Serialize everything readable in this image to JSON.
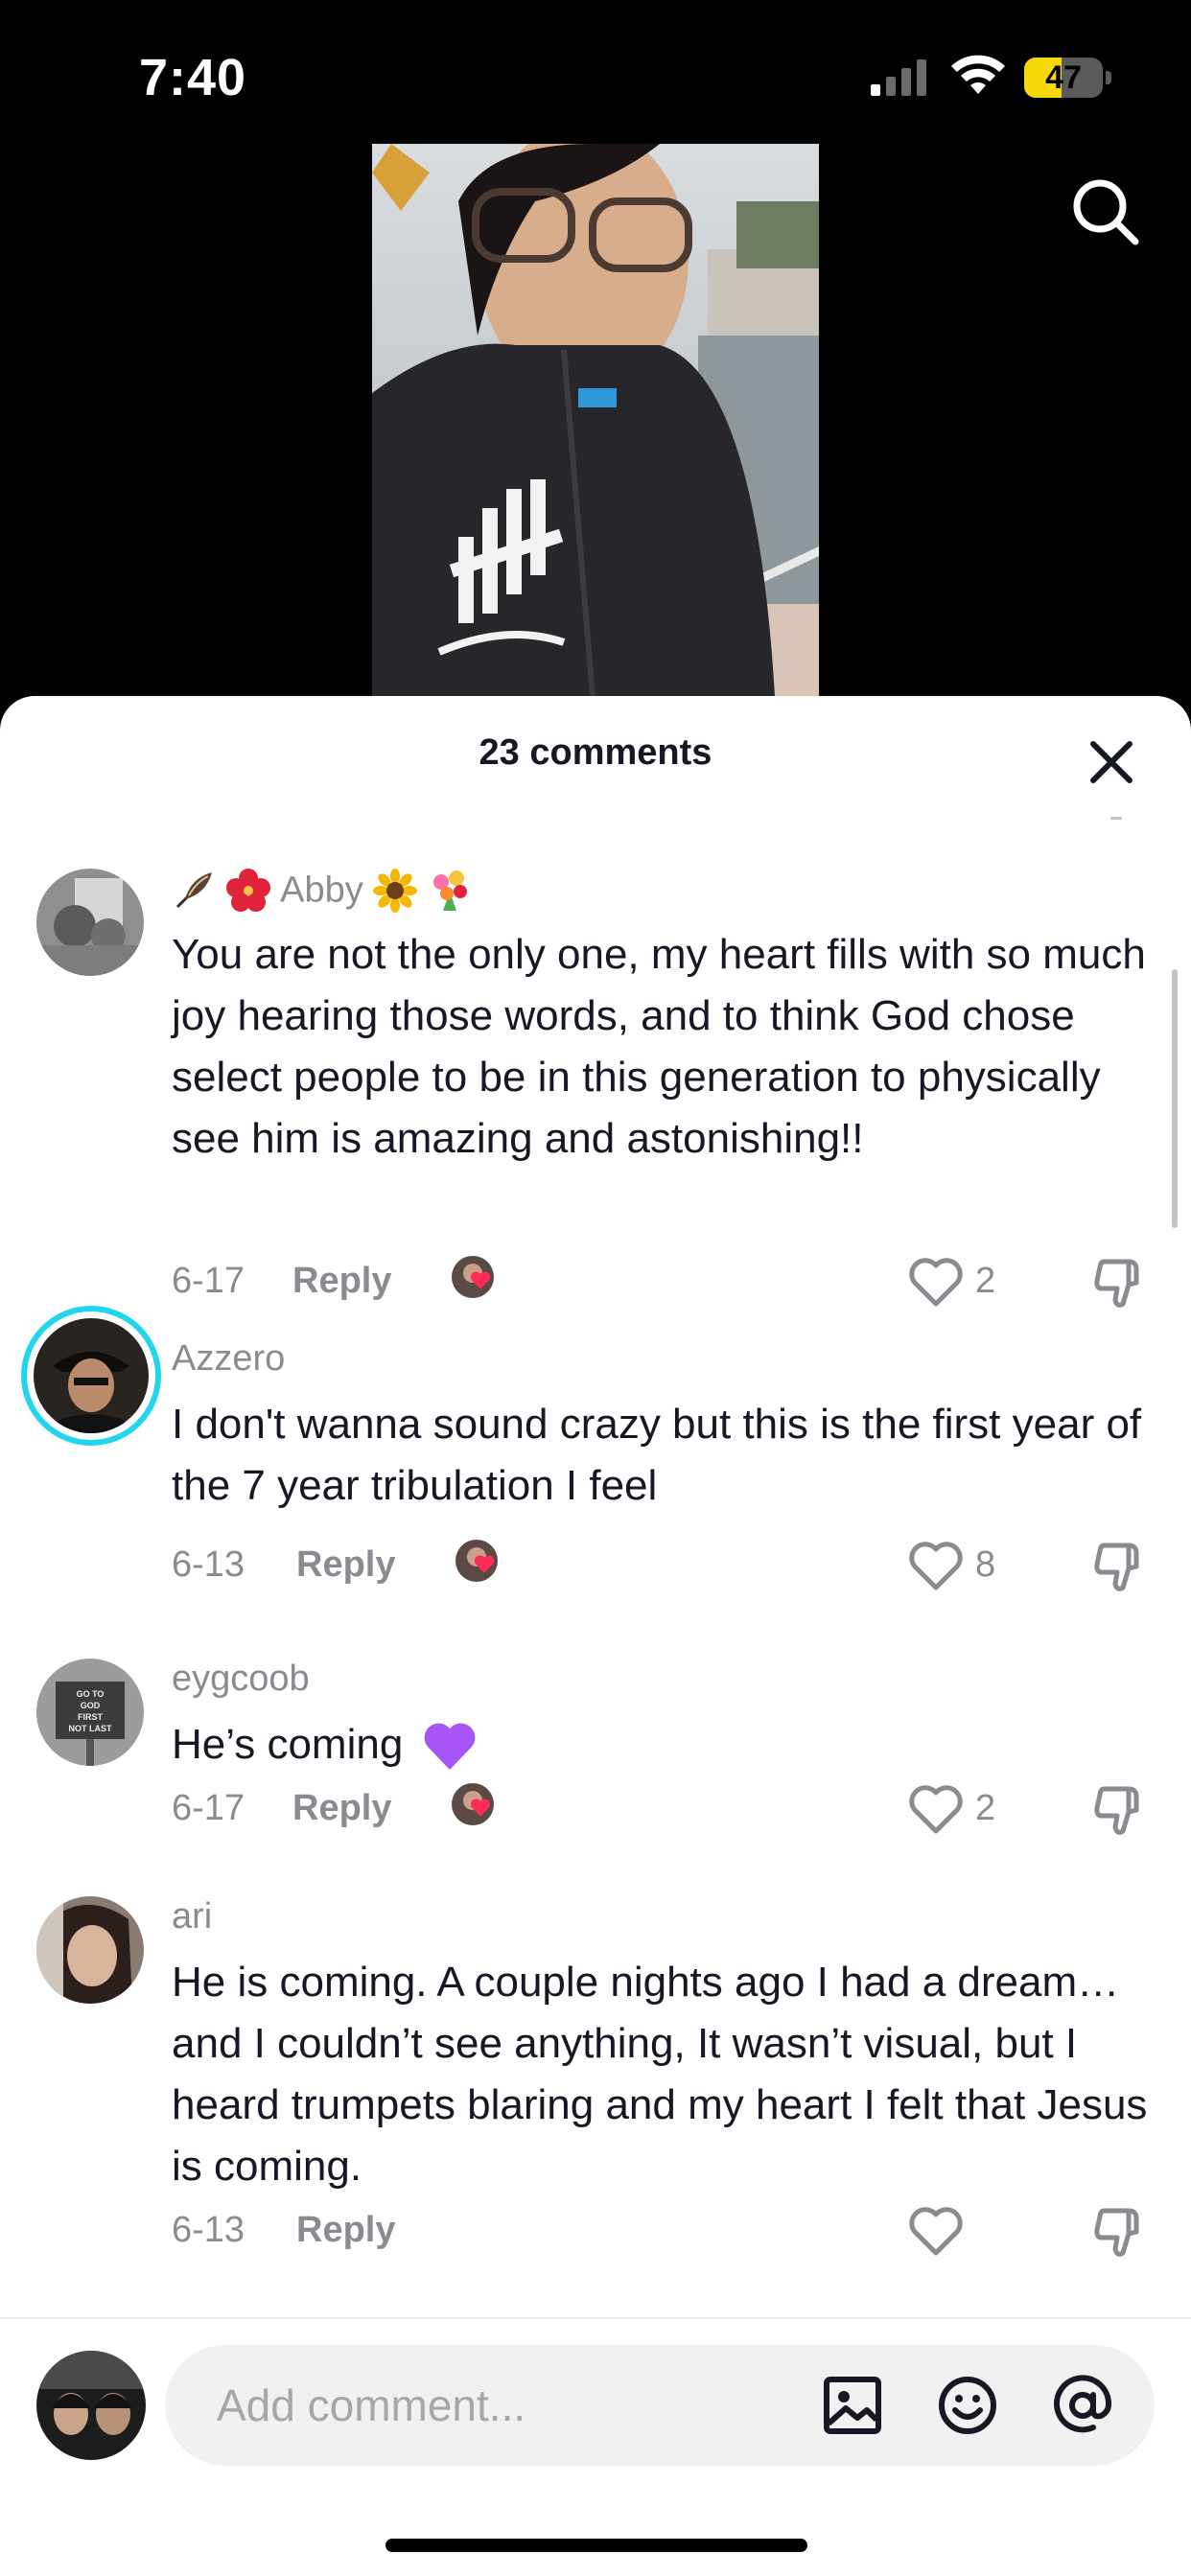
{
  "status_bar": {
    "time": "7:40",
    "battery": "47",
    "battery_level": 0.47
  },
  "sheet": {
    "title": "23 comments"
  },
  "comments": [
    {
      "username": "Abby",
      "username_prefix_emojis": [
        "feather-emoji",
        "hibiscus-emoji"
      ],
      "username_suffix_emojis": [
        "sunflower-emoji",
        "bouquet-emoji"
      ],
      "text": "You are not the only one, my heart fills with so much joy hearing those words, and to think God chose select people to be in this generation to physically see him is amazing and astonishing!!",
      "date": "6-17",
      "reply_label": "Reply",
      "likes": "2",
      "liked_by_creator": true
    },
    {
      "username": "Azzero",
      "text": "I don't wanna sound crazy but this is the first year of the 7 year tribulation I feel",
      "date": "6-13",
      "reply_label": "Reply",
      "likes": "8",
      "liked_by_creator": true,
      "has_story_ring": true
    },
    {
      "username": "eygcoob",
      "text": "He’s coming",
      "text_emoji": "purple-heart-emoji",
      "date": "6-17",
      "reply_label": "Reply",
      "likes": "2",
      "liked_by_creator": true,
      "avatar_sign_text": [
        "GO TO",
        "GOD",
        "FIRST",
        "NOT LAST"
      ]
    },
    {
      "username": "ari",
      "text": "He is coming. A couple nights ago I had a dream… and I couldn’t see anything, It wasn’t visual, but I heard trumpets blaring and my heart I felt that Jesus is coming.",
      "date": "6-13",
      "reply_label": "Reply",
      "likes": "",
      "liked_by_creator": false
    }
  ],
  "composer": {
    "placeholder": "Add comment..."
  },
  "colors": {
    "story_ring": "#20d5ec",
    "creator_heart": "#fe2c55",
    "battery": "#f5d90a",
    "purple_heart": "#a855f7"
  }
}
